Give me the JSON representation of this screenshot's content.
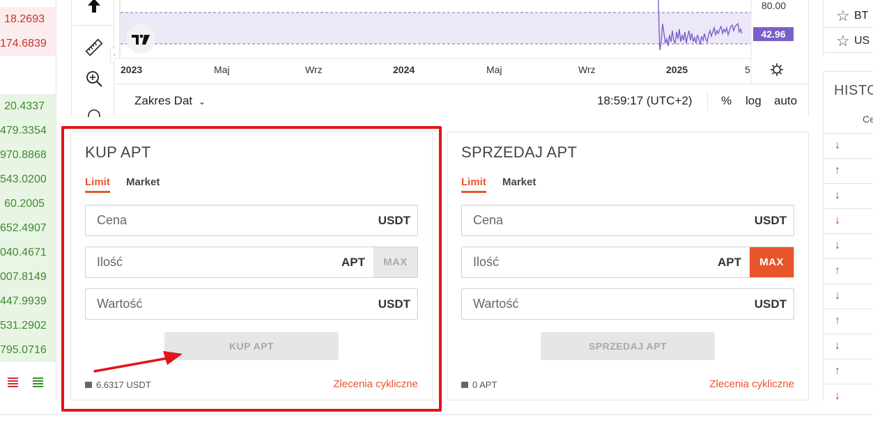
{
  "orderbook": {
    "asks": [
      "18.2693",
      "174.6839"
    ],
    "bids": [
      "20.4337",
      "479.3354",
      "970.8868",
      "543.0200",
      "60.2005",
      "652.4907",
      "040.4671",
      "007.8149",
      "447.9939",
      "531.2902",
      "795.0716"
    ]
  },
  "chart": {
    "x_labels": [
      {
        "text": "2023",
        "bold": true
      },
      {
        "text": "Maj",
        "bold": false
      },
      {
        "text": "Wrz",
        "bold": false
      },
      {
        "text": "2024",
        "bold": true
      },
      {
        "text": "Maj",
        "bold": false
      },
      {
        "text": "Wrz",
        "bold": false
      },
      {
        "text": "2025",
        "bold": true
      },
      {
        "text": "5",
        "bold": false
      }
    ],
    "price_top": "80.00",
    "price_current": "42.96",
    "accent_color": "#7b5fc9",
    "footer": {
      "date_range_label": "Zakres Dat",
      "clock": "18:59:17 (UTC+2)",
      "percent": "%",
      "log": "log",
      "auto": "auto"
    }
  },
  "favorites": [
    {
      "name": "BT"
    },
    {
      "name": "US"
    }
  ],
  "history": {
    "title": "HISTO",
    "column": "Ce",
    "rows": [
      "down",
      "up",
      "down",
      "down",
      "down",
      "up",
      "down",
      "up",
      "down",
      "up",
      "down"
    ]
  },
  "buy_panel": {
    "title": "KUP APT",
    "tabs": [
      "Limit",
      "Market"
    ],
    "price_placeholder": "Cena",
    "price_unit": "USDT",
    "amount_placeholder": "Ilość",
    "amount_unit": "APT",
    "max_label": "MAX",
    "value_placeholder": "Wartość",
    "value_unit": "USDT",
    "submit_label": "KUP APT",
    "balance": "6.6317 USDT",
    "recurring_label": "Zlecenia cykliczne"
  },
  "sell_panel": {
    "title": "SPRZEDAJ APT",
    "tabs": [
      "Limit",
      "Market"
    ],
    "price_placeholder": "Cena",
    "price_unit": "USDT",
    "amount_placeholder": "Ilość",
    "amount_unit": "APT",
    "max_label": "MAX",
    "value_placeholder": "Wartość",
    "value_unit": "USDT",
    "submit_label": "SPRZEDAJ APT",
    "balance": "0 APT",
    "recurring_label": "Zlecenia cykliczne"
  },
  "colors": {
    "brand": "#e8552a",
    "ask": "#c9302c",
    "bid": "#3d8a2f",
    "highlight": "#e0141a"
  }
}
